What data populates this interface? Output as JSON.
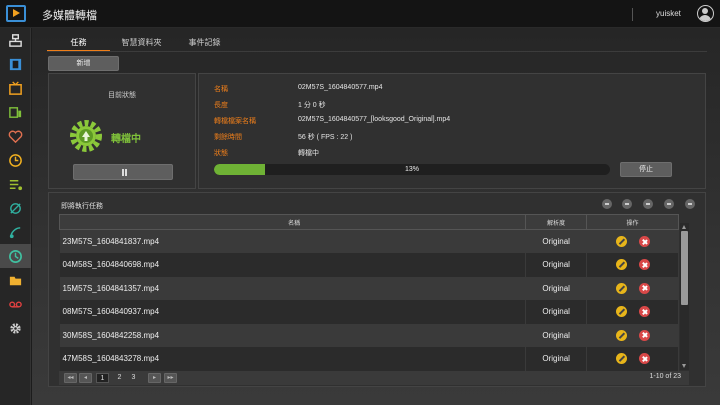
{
  "app": {
    "title": "多媒體轉檔",
    "username": "yuisket"
  },
  "tabs": [
    {
      "label": "任務",
      "active": true
    },
    {
      "label": "智慧資料夾",
      "active": false
    },
    {
      "label": "事件記錄",
      "active": false
    }
  ],
  "toolbar": {
    "add_label": "新增"
  },
  "status": {
    "title": "目前狀態",
    "state": "轉檔中",
    "pause_icon": "pause-icon"
  },
  "current_task": {
    "rows": [
      {
        "label": "名稱",
        "value": "02M57S_1604840577.mp4"
      },
      {
        "label": "長度",
        "value": "1 分 0 秒"
      },
      {
        "label": "轉檔檔案名稱",
        "value": "02M57S_1604840577_[looksgood_Original].mp4"
      },
      {
        "label": "剩餘時間",
        "value": "56 秒 ( FPS : 22 )"
      },
      {
        "label": "狀態",
        "value": "轉檔中"
      }
    ],
    "progress_percent": 13,
    "progress_text": "13%",
    "stop_label": "停止"
  },
  "queue": {
    "title": "即將執行任務",
    "columns": {
      "name": "名稱",
      "resolution": "解析度",
      "ops": "操作"
    },
    "rows": [
      {
        "name": "23M57S_1604841837.mp4",
        "resolution": "Original"
      },
      {
        "name": "04M58S_1604840698.mp4",
        "resolution": "Original"
      },
      {
        "name": "15M57S_1604841357.mp4",
        "resolution": "Original"
      },
      {
        "name": "08M57S_1604840937.mp4",
        "resolution": "Original"
      },
      {
        "name": "30M58S_1604842258.mp4",
        "resolution": "Original"
      },
      {
        "name": "47M58S_1604843278.mp4",
        "resolution": "Original"
      }
    ],
    "pages": [
      "1",
      "2",
      "3"
    ],
    "total_text": "1-10 of 23"
  },
  "colors": {
    "accent": "#f07f1a",
    "progress": "#6fb235",
    "edit": "#e8b51a",
    "delete": "#d94848"
  }
}
